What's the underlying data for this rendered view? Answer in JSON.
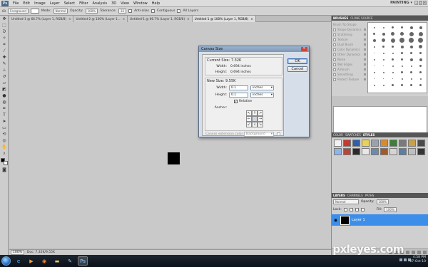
{
  "app": {
    "logo": "Ps",
    "workspace": "PAINTING ▾"
  },
  "menu": [
    "File",
    "Edit",
    "Image",
    "Layer",
    "Select",
    "Filter",
    "Analysis",
    "3D",
    "View",
    "Window",
    "Help"
  ],
  "options_bar": {
    "tool_preset": "Foreground",
    "mode_label": "Mode:",
    "mode_value": "Normal",
    "opacity_label": "Opacity:",
    "opacity_value": "100%",
    "tolerance_label": "Tolerance:",
    "tolerance_value": "32",
    "antialias": "Anti-alias",
    "contiguous": "Contiguous",
    "all_layers": "All Layers"
  },
  "doc_tabs": [
    {
      "label": "Untitled-1 @ 66.7% (Layer 1, RGB/8)",
      "active": false
    },
    {
      "label": "Untitled-2 @ 100% (Layer 1...",
      "active": false
    },
    {
      "label": "Untitled-1 @ 66.7% (Layer 1, RGB/8)",
      "active": false
    },
    {
      "label": "Untitled-1 @ 100% (Layer 1, RGB/8)",
      "active": true
    }
  ],
  "status": {
    "zoom": "100%",
    "doc": "Doc: 7.32K/9.55K"
  },
  "dialog": {
    "title": "Canvas Size",
    "current_size": "Current Size: 7.32K",
    "current_width_label": "Width:",
    "current_width_value": "0.694 inches",
    "current_height_label": "Height:",
    "current_height_value": "0.694 inches",
    "new_size": "New Size: 9.55K",
    "width_label": "Width:",
    "width_value": "0.1",
    "width_unit": "inches",
    "height_label": "Height:",
    "height_value": "0.1",
    "height_unit": "inches",
    "relative_label": "Relative",
    "relative_checked": true,
    "anchor_label": "Anchor:",
    "anchor_arrows": [
      "↖",
      "↑",
      "↗",
      "←",
      "",
      "→",
      "↙",
      "↓",
      "↘"
    ],
    "extension_label": "Canvas extension color:",
    "extension_value": "Background",
    "ok_label": "OK",
    "cancel_label": "Cancel"
  },
  "panels": {
    "brushes_tabs": [
      "BRUSHES",
      "CLONE SOURCE"
    ],
    "brush_presets": [
      "Brush Tip Shape",
      "Shape Dynamics",
      "Scattering",
      "Texture",
      "Dual Brush",
      "Color Dynamics",
      "Other Dynamics",
      "Noise",
      "Wet Edges",
      "Airbrush",
      "Smoothing",
      "Protect Texture"
    ],
    "styles_tabs": [
      "COLOR",
      "SWATCHES",
      "STYLES"
    ],
    "layers_tabs": [
      "LAYERS",
      "CHANNELS",
      "PATHS"
    ],
    "blend_mode": "Normal",
    "opacity_label": "Opacity:",
    "opacity_value": "100%",
    "lock_label": "Lock:",
    "fill_label": "Fill:",
    "fill_value": "100%",
    "layer_name": "Layer 1"
  },
  "taskbar": {
    "time": "4:58 PM",
    "date": "07-Oct-10"
  },
  "watermark": "pxleyes.com",
  "colors": {
    "foreground": "#000000",
    "background": "#ffffff",
    "selected_layer": "#3d8ee8",
    "canvas": "#c9c9c9"
  }
}
